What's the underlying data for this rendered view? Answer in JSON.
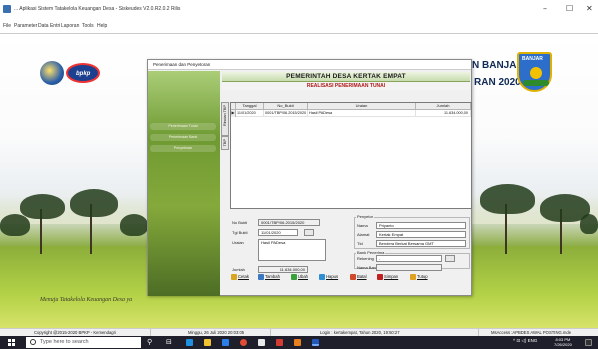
{
  "app": {
    "title": "... Aplikasi Sistem Tatakelola Keuangan Desa - Siskeudes V2.0.R2.0.2 Rilis",
    "window_controls": {
      "minimize": "–",
      "maximize": "☐",
      "close": "✕"
    }
  },
  "menu": [
    "File",
    "Parameter",
    "Data Entri",
    "Laporan",
    "Tools",
    "Help"
  ],
  "desktop": {
    "banner_line1": "N BANJAR",
    "banner_line2": "RAN 2020",
    "crest_label": "BANJAR",
    "bpkp_logo_text": "bpkp",
    "tagline": "Menuju Tatakelola Keuangan Desa ya"
  },
  "dialog": {
    "title": "Penerimaan dan Penyetoran",
    "header": "PEMERINTAH DESA KERTAK EMPAT",
    "subheader": "REALISASI PENERIMAAN TUNAI",
    "side_menu": [
      "Penerimaan Tunai",
      "Penerimaan Bank",
      "Penyetoran"
    ],
    "vertical_tabs": [
      "Rincian TBP",
      "TBP"
    ],
    "grid": {
      "columns": [
        "Tanggal",
        "No_Bukti",
        "Uraian",
        "Jumlah"
      ],
      "rows": [
        {
          "selector": "▶",
          "tanggal": "11/01/2020",
          "no_bukti": "0001/TBP/06.2015/2020",
          "uraian": "Hasil PADesa",
          "jumlah": "11.634.000,00"
        }
      ]
    },
    "form": {
      "no_bukti_label": "No Bukti",
      "no_bukti_value": "0001/TBP/06.2015/2020",
      "tgl_bukti_label": "Tgl Bukti",
      "tgl_bukti_value": "11/01/2020",
      "uraian_label": "Uraian",
      "uraian_value": "Hasil PADesa",
      "jumlah_label": "Jumlah",
      "jumlah_value": "11.634.000,00"
    },
    "penyetor": {
      "caption": "Penyetor",
      "nama_label": "Nama",
      "nama_value": "Priyanto",
      "alamat_label": "Alamat",
      "alamat_value": "Kertak Empat",
      "ttd_label": "Ttd",
      "ttd_value": "Bendera Berkat Bersama GMT"
    },
    "bank": {
      "caption": "Bank Penerima",
      "rekening_label": "Rekening",
      "rekening_value": "-",
      "nama_bank_label": "Nama Bank",
      "nama_bank_value": ""
    },
    "buttons": [
      {
        "name": "cetak-button",
        "label": "Cetak",
        "accent": "#d9a520"
      },
      {
        "name": "tambah-button",
        "label": "Tambah",
        "accent": "#3a78c2"
      },
      {
        "name": "ubah-button",
        "label": "Ubah",
        "accent": "#3aa03a"
      },
      {
        "name": "hapus-button",
        "label": "Hapus",
        "accent": "#2f8fd0"
      },
      {
        "name": "batal-button",
        "label": "Batal",
        "accent": "#d04b2b"
      },
      {
        "name": "simpan-button",
        "label": "Simpan",
        "accent": "#c02020"
      },
      {
        "name": "tutup-button",
        "label": "Tutup",
        "accent": "#e0a020"
      }
    ]
  },
  "statusbar": {
    "copyright": "Copyright @2015-2020 BPKP - Kemendagri",
    "date": "Minggu, 26 Juli 2020  20:03:05",
    "login": "Login : kertakempat, Tahun 2020, 19:50:27",
    "db": "MsAccess :APBDES AWAL POSTING.mde"
  },
  "taskbar": {
    "search_placeholder": "Type here to search",
    "time": "8:03 PM",
    "date": "7/26/2020",
    "tray_text": "^ ⊡ ◁) ENG"
  }
}
